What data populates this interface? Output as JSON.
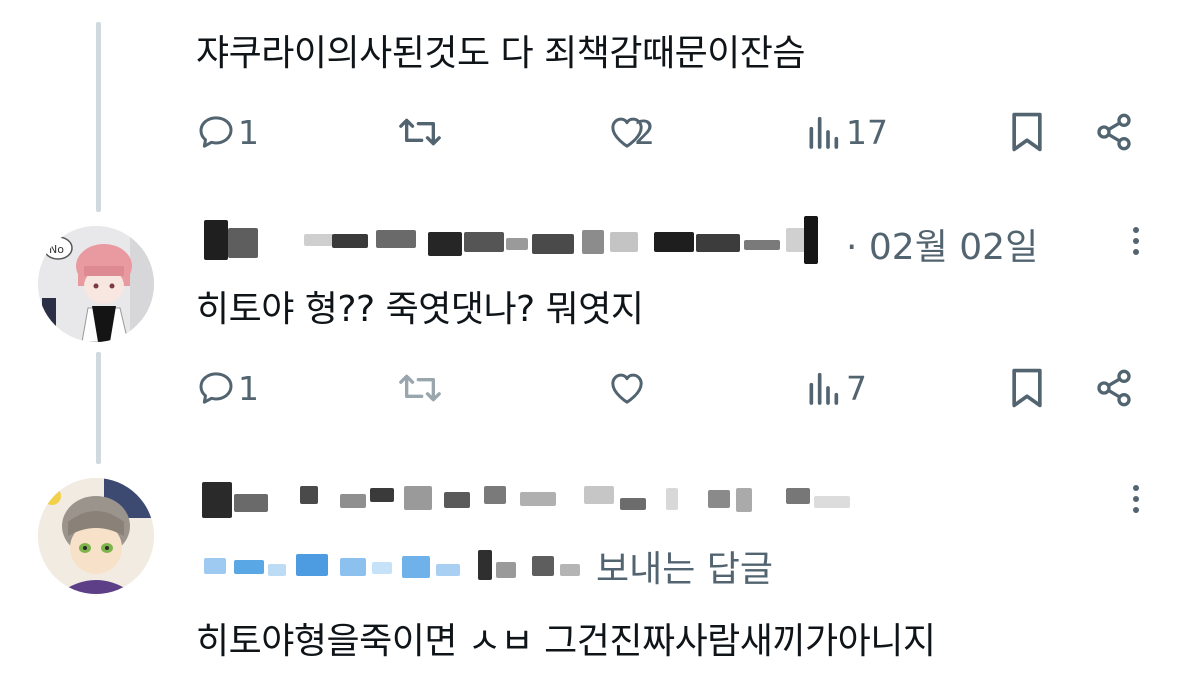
{
  "colors": {
    "text": "#0f1419",
    "muted": "#536471",
    "line": "#cfd9de"
  },
  "tweets": [
    {
      "text": "쟈쿠라이의사된것도 다 죄책감때문이잔슴",
      "reply_count": "1",
      "retweet_count": "",
      "like_count": "2",
      "view_count": "17"
    },
    {
      "date": "· 02월 02일",
      "text": "히토야 형?? 죽엿댓나? 뭐엿지",
      "reply_count": "1",
      "retweet_count": "",
      "like_count": "",
      "view_count": "7"
    },
    {
      "reply_context": "보내는 답글",
      "text": "히토야형을죽이면 ㅅㅂ 그건진짜사람새끼가아니지"
    }
  ],
  "icons": {
    "reply": "reply-icon",
    "retweet": "retweet-icon",
    "like": "heart-icon",
    "views": "views-icon",
    "bookmark": "bookmark-icon",
    "share": "share-icon",
    "more": "more-icon"
  }
}
